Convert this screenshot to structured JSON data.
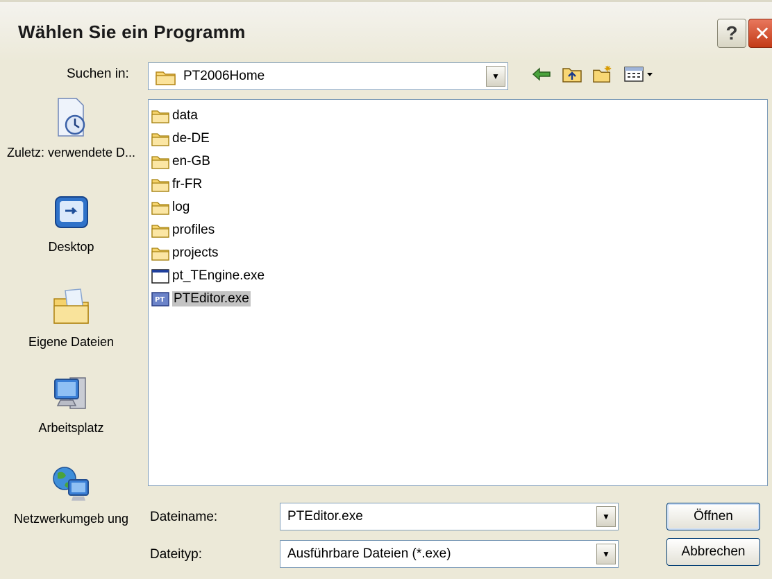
{
  "window": {
    "title": "Wählen Sie ein Programm",
    "help_label": "?",
    "close_label": "✕"
  },
  "look_in": {
    "label": "Suchen in:",
    "value": "PT2006Home"
  },
  "places": [
    {
      "label": "Zuletz: verwendete D...",
      "icon": "recent-documents-icon"
    },
    {
      "label": "Desktop",
      "icon": "desktop-icon"
    },
    {
      "label": "Eigene Dateien",
      "icon": "my-documents-icon"
    },
    {
      "label": "Arbeitsplatz",
      "icon": "my-computer-icon"
    },
    {
      "label": "Netzwerkumgeb ung",
      "icon": "network-icon"
    }
  ],
  "files": [
    {
      "name": "data",
      "type": "folder"
    },
    {
      "name": "de-DE",
      "type": "folder"
    },
    {
      "name": "en-GB",
      "type": "folder"
    },
    {
      "name": "fr-FR",
      "type": "folder"
    },
    {
      "name": "log",
      "type": "folder"
    },
    {
      "name": "profiles",
      "type": "folder"
    },
    {
      "name": "projects",
      "type": "folder"
    },
    {
      "name": "pt_TEngine.exe",
      "type": "exe"
    },
    {
      "name": "PTEditor.exe",
      "type": "exe-app",
      "selected": true
    }
  ],
  "filename": {
    "label": "Dateiname:",
    "value": "PTEditor.exe"
  },
  "filetype": {
    "label": "Dateityp:",
    "value": "Ausführbare Dateien (*.exe)"
  },
  "buttons": {
    "open": "Öffnen",
    "cancel": "Abbrechen"
  }
}
